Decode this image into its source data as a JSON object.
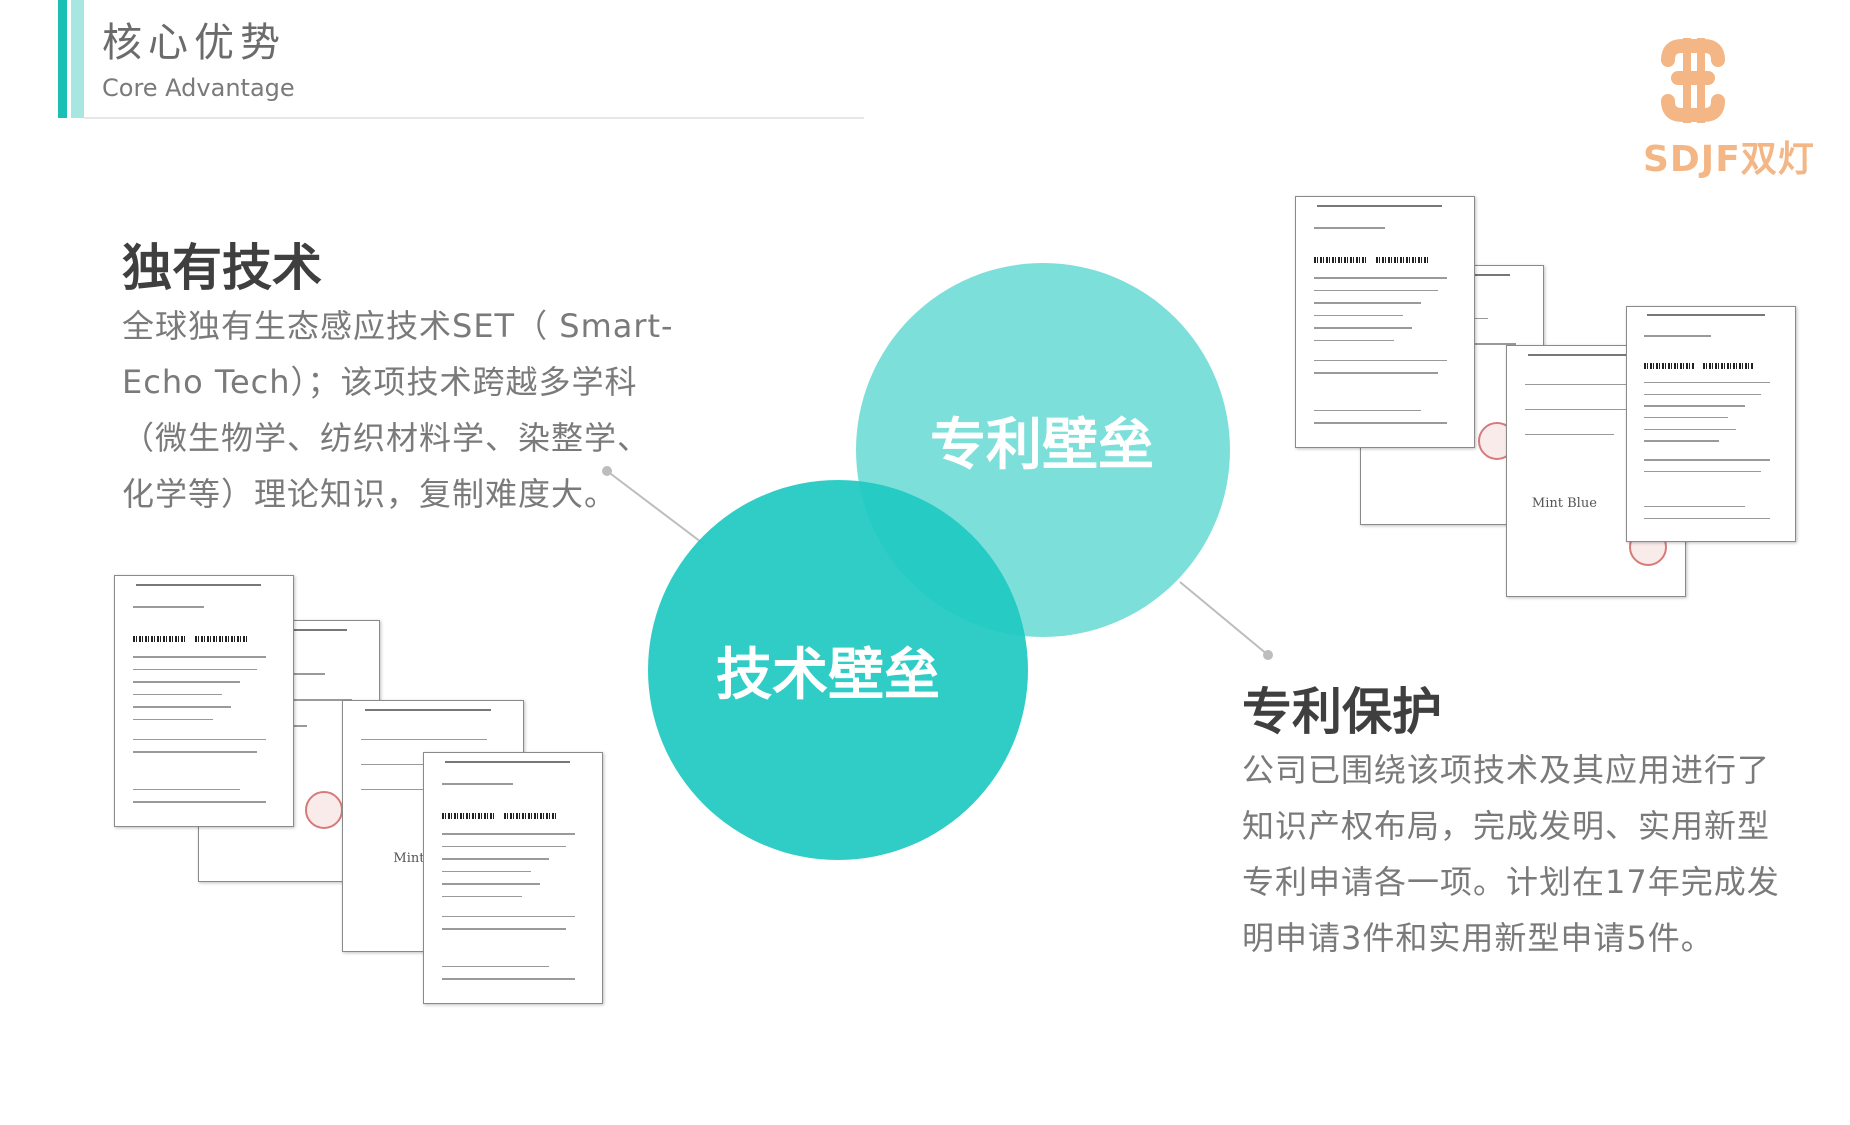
{
  "header": {
    "title": "核心优势",
    "subtitle": "Core Advantage"
  },
  "logo": {
    "text": "SDJF双灯"
  },
  "left_block": {
    "heading": "独有技术",
    "body": "全球独有生态感应技术SET（ Smart-Echo Tech）；该项技术跨越多学科（微生物学、纺织材料学、染整学、化学等）理论知识，复制难度大。"
  },
  "right_block": {
    "heading": "专利保护",
    "body": "公司已围绕该项技术及其应用进行了知识产权布局，完成发明、实用新型专利申请各一项。计划在17年完成发明申请3件和实用新型申请5件。"
  },
  "circles": {
    "patent_label": "专利壁垒",
    "tech_label": "技术壁垒"
  },
  "documents": {
    "mint_label": "Mint Blue"
  },
  "colors": {
    "accent": "#1bbfb4",
    "accent_light": "#a7e6e1",
    "circle_tech": "#1ec9c2",
    "circle_patent": "#6fdcd6",
    "logo": "#f3b684"
  }
}
